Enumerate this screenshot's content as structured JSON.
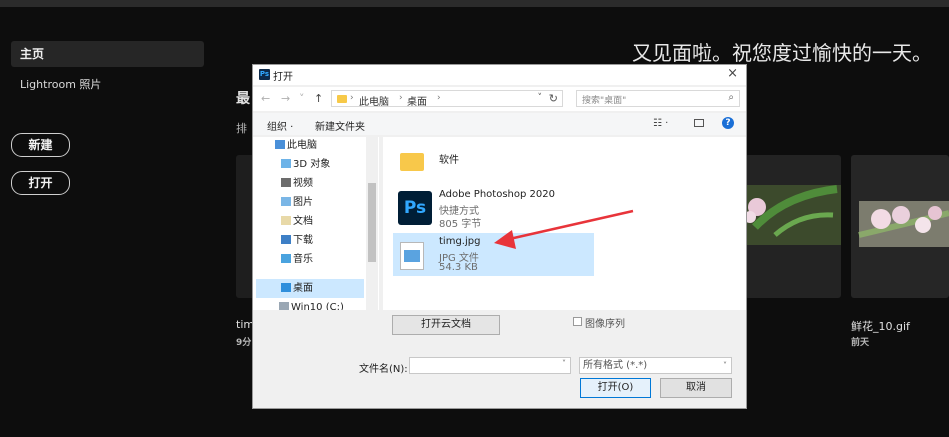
{
  "home": {
    "nav_home": "主页",
    "nav_lightroom": "Lightroom 照片",
    "new_button": "新建",
    "open_button": "打开",
    "greeting": "又见面啦。祝您度过愉快的一天。",
    "recent_header_fragment": "最",
    "sort_fragment": "排",
    "recent_file_left_name": "tim",
    "recent_file_left_time": "9分",
    "recent_file_right_name": "鲜花_10.gif",
    "recent_file_right_time": "前天"
  },
  "dialog": {
    "title": "打开",
    "close_glyph": "×",
    "ps_badge": "Ps",
    "address": {
      "crumbs": [
        "此电脑",
        "桌面"
      ]
    },
    "search_placeholder": "搜索\"桌面\"",
    "toolbar": {
      "organize": "组织 ·",
      "new_folder": "新建文件夹",
      "help": "?"
    },
    "tree": [
      {
        "label": "此电脑",
        "icon": "computer-icon"
      },
      {
        "label": "3D 对象",
        "icon": "cube-folder-icon"
      },
      {
        "label": "视频",
        "icon": "video-folder-icon"
      },
      {
        "label": "图片",
        "icon": "picture-folder-icon"
      },
      {
        "label": "文档",
        "icon": "document-folder-icon"
      },
      {
        "label": "下载",
        "icon": "download-folder-icon"
      },
      {
        "label": "音乐",
        "icon": "music-folder-icon"
      },
      {
        "label": "桌面",
        "icon": "desktop-folder-icon"
      },
      {
        "label": "Win10 (C:)",
        "icon": "drive-icon"
      }
    ],
    "files": [
      {
        "name": "软件",
        "icon": "folder-icon"
      },
      {
        "name": "Adobe Photoshop 2020",
        "meta1": "快捷方式",
        "meta2": "805 字节",
        "icon": "photoshop-icon"
      },
      {
        "name": "timg.jpg",
        "meta1": "JPG 文件",
        "meta2": "54.3 KB",
        "icon": "image-file-icon"
      }
    ],
    "cloud_button": "打开云文档",
    "image_sequence": "图像序列",
    "filename_label": "文件名(N):",
    "filename_value": "",
    "format_value": "所有格式 (*.*)",
    "open_button": "打开(O)",
    "cancel_button": "取消"
  },
  "colors": {
    "annotation_arrow": "#e8343a",
    "selection": "#cce8ff",
    "accent": "#0078d7"
  }
}
